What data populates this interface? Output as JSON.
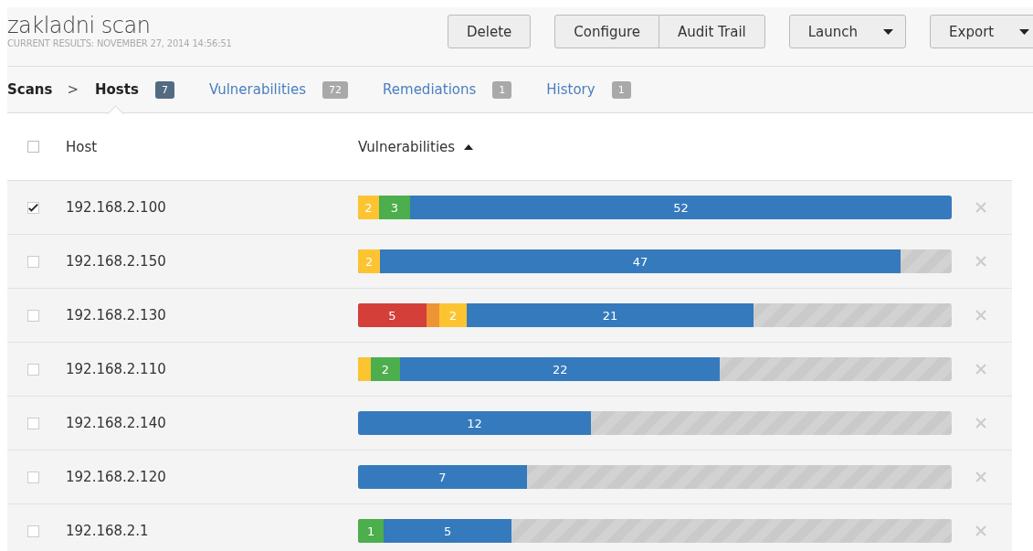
{
  "header": {
    "title": "zakladni scan",
    "subtitle": "CURRENT RESULTS: NOVEMBER 27, 2014 14:56:51",
    "button_groups": [
      [
        {
          "label": "Delete",
          "kind": "plain"
        }
      ],
      [
        {
          "label": "Configure",
          "kind": "plain"
        },
        {
          "label": "Audit Trail",
          "kind": "plain"
        }
      ],
      [
        {
          "label": "Launch",
          "kind": "dropdown"
        }
      ],
      [
        {
          "label": "Export",
          "kind": "dropdown"
        }
      ]
    ]
  },
  "breadcrumb": {
    "root": "Scans",
    "separator": ">"
  },
  "tabs": [
    {
      "label": "Hosts",
      "count": "7",
      "selected": true
    },
    {
      "label": "Vulnerabilities",
      "count": "72",
      "selected": false
    },
    {
      "label": "Remediations",
      "count": "1",
      "selected": false
    },
    {
      "label": "History",
      "count": "1",
      "selected": false
    }
  ],
  "table": {
    "columns": [
      {
        "label": "Host",
        "sorted": false
      },
      {
        "label": "Vulnerabilities",
        "sorted": true
      }
    ],
    "all_checked": false,
    "rows": [
      {
        "host": "192.168.2.100",
        "checked": true,
        "segments": [
          {
            "kind": "medium",
            "label": "2"
          },
          {
            "kind": "low",
            "label": "3"
          },
          {
            "kind": "info",
            "label": "52"
          }
        ]
      },
      {
        "host": "192.168.2.150",
        "checked": false,
        "segments": [
          {
            "kind": "medium",
            "label": "2"
          },
          {
            "kind": "info",
            "label": "47"
          }
        ]
      },
      {
        "host": "192.168.2.130",
        "checked": false,
        "segments": [
          {
            "kind": "critical",
            "label": "5"
          },
          {
            "kind": "high"
          },
          {
            "kind": "medium",
            "label": "2"
          },
          {
            "kind": "info",
            "label": "21"
          }
        ]
      },
      {
        "host": "192.168.2.110",
        "checked": false,
        "segments": [
          {
            "kind": "medium"
          },
          {
            "kind": "low",
            "label": "2"
          },
          {
            "kind": "info",
            "label": "22"
          }
        ]
      },
      {
        "host": "192.168.2.140",
        "checked": false,
        "segments": [
          {
            "kind": "info",
            "label": "12"
          }
        ]
      },
      {
        "host": "192.168.2.120",
        "checked": false,
        "segments": [
          {
            "kind": "info",
            "label": "7"
          }
        ]
      },
      {
        "host": "192.168.2.1",
        "checked": false,
        "segments": [
          {
            "kind": "low",
            "label": "1"
          },
          {
            "kind": "info",
            "label": "5"
          }
        ]
      }
    ]
  }
}
